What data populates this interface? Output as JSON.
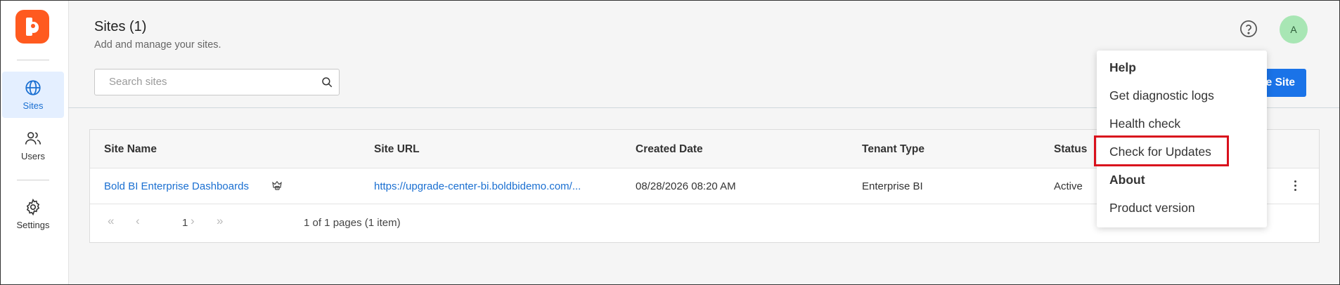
{
  "sidebar": {
    "items": [
      {
        "label": "Sites",
        "icon": "globe-icon"
      },
      {
        "label": "Users",
        "icon": "users-icon"
      },
      {
        "label": "Settings",
        "icon": "gear-icon"
      }
    ]
  },
  "header": {
    "title": "Sites (1)",
    "subtitle": "Add and manage your sites.",
    "avatar_initial": "A"
  },
  "search": {
    "placeholder": "Search sites"
  },
  "create_button": {
    "label": "e Site"
  },
  "table": {
    "columns": [
      "Site Name",
      "Site URL",
      "Created Date",
      "Tenant Type",
      "Status"
    ],
    "rows": [
      {
        "site_name": "Bold BI Enterprise Dashboards",
        "site_url": "https://upgrade-center-bi.boldbidemo.com/...",
        "created_date": "08/28/2026 08:20 AM",
        "tenant_type": "Enterprise BI",
        "status": "Active"
      }
    ]
  },
  "pager": {
    "first": "«",
    "prev": "‹",
    "page": "1",
    "next": "›",
    "last": "»",
    "info": "1 of 1 pages (1 item)"
  },
  "dropdown": {
    "help_heading": "Help",
    "diagnostic_logs": "Get diagnostic logs",
    "health_check": "Health check",
    "check_updates": "Check for Updates",
    "about_heading": "About",
    "product_version": "Product version"
  },
  "colors": {
    "brand": "#ff5a1f",
    "primary": "#1a73e8",
    "link": "#1a6fd1",
    "highlight": "#d9101c",
    "avatar": "#a8e6b4"
  }
}
